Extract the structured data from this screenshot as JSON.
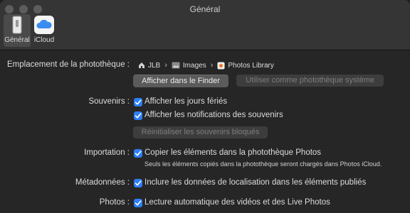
{
  "window": {
    "title": "Général"
  },
  "toolbar": {
    "tabs": [
      {
        "label": "Général",
        "icon": "general-settings-icon",
        "active": true
      },
      {
        "label": "iCloud",
        "icon": "icloud-icon",
        "active": false
      }
    ]
  },
  "library": {
    "label": "Emplacement de la photothèque :",
    "path": [
      "JLB",
      "Images",
      "Photos Library"
    ],
    "show_in_finder": "Afficher dans le Finder",
    "use_as_system": "Utiliser comme photothèque système"
  },
  "memories": {
    "label": "Souvenirs :",
    "show_holidays": "Afficher les jours fériés",
    "show_notifications": "Afficher les notifications des souvenirs",
    "reset_blocked": "Réinitialiser les souvenirs bloqués"
  },
  "import": {
    "label": "Importation :",
    "copy_items": "Copier les éléments dans la photothèque Photos",
    "note": "Seuls les éléments copiés dans la photothèque seront chargés dans Photos iCloud."
  },
  "metadata": {
    "label": "Métadonnées :",
    "include_location": "Inclure les données de localisation dans les éléments publiés"
  },
  "photos": {
    "label": "Photos :",
    "autoplay": "Lecture automatique des vidéos et des Live Photos"
  },
  "colors": {
    "accent": "#2e7ef6",
    "background": "#262626",
    "toolbar": "#353535"
  }
}
